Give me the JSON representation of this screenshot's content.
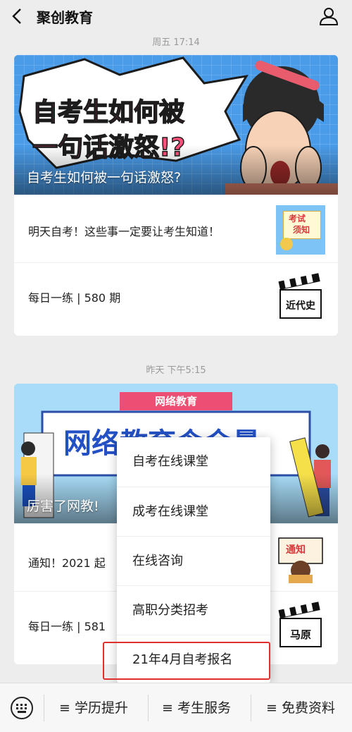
{
  "header": {
    "title": "聚创教育",
    "back_icon": "chevron-left-icon",
    "profile_icon": "user-icon"
  },
  "groups": [
    {
      "time": "周五 17:14",
      "banner": {
        "headline_line1": "自考生如何被",
        "headline_line2": "一句话激怒!?",
        "caption": "自考生如何被一句话激怒?"
      },
      "items": [
        {
          "text": "明天自考！这些事一定要让考生知道！",
          "thumb_text_1": "考试",
          "thumb_text_2": "须知"
        },
        {
          "text": "每日一练 | 580 期",
          "thumb_text_1": "近代史"
        }
      ]
    },
    {
      "time": "昨天 下午5:15",
      "banner": {
        "tag": "网络教育",
        "headline": "网络教育含金量",
        "caption": "厉害了网教!"
      },
      "items": [
        {
          "text": "通知！2021 起",
          "thumb_text_1": "通知"
        },
        {
          "text": "每日一练 | 581",
          "thumb_text_1": "马原"
        }
      ]
    }
  ],
  "popup_menu": {
    "items": [
      "自考在线课堂",
      "成考在线课堂",
      "在线咨询",
      "高职分类招考",
      "21年4月自考报名"
    ],
    "highlighted_index": 4,
    "highlight_color": "#e0302e"
  },
  "bottom_bar": {
    "keyboard_icon": "keyboard-icon",
    "tabs": [
      "≡ 学历提升",
      "≡ 考生服务",
      "≡ 免费资料"
    ]
  }
}
